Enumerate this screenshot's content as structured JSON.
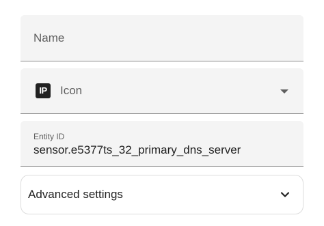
{
  "form": {
    "name_field": {
      "placeholder": "Name",
      "value": ""
    },
    "icon_field": {
      "icon_glyph": "IP",
      "label": "Icon",
      "icon_name": "ip-icon"
    },
    "entity_field": {
      "label": "Entity ID",
      "value": "sensor.e5377ts_32_primary_dns_server"
    },
    "advanced": {
      "label": "Advanced settings",
      "expanded": false
    }
  },
  "colors": {
    "field_bg": "#f4f4f4",
    "text_primary": "#212121",
    "text_secondary": "#5f5f5f"
  }
}
